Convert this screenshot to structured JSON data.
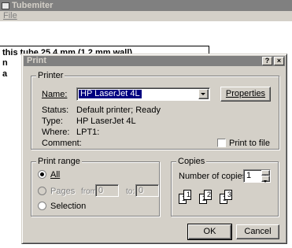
{
  "app": {
    "title": "Tubemiter",
    "menu": {
      "file": "File"
    },
    "document_lines": [
      "this tube 25.4 mm (1.2 mm wall)",
      "n",
      "a"
    ]
  },
  "dialog": {
    "title": "Print",
    "help_glyph": "?",
    "close_glyph": "×",
    "printer": {
      "group_label": "Printer",
      "name_label": "Name:",
      "name_value": "HP LaserJet 4L",
      "properties_button": "Properties",
      "status_label": "Status:",
      "status_value": "Default printer; Ready",
      "type_label": "Type:",
      "type_value": "HP LaserJet 4L",
      "where_label": "Where:",
      "where_value": "LPT1:",
      "comment_label": "Comment:",
      "print_to_file_label": "Print to file",
      "print_to_file_checked": false
    },
    "print_range": {
      "group_label": "Print range",
      "all_label": "All",
      "pages_label": "Pages",
      "from_label": "from:",
      "from_value": "0",
      "to_label": "to:",
      "to_value": "0",
      "selection_label": "Selection",
      "selected": "all"
    },
    "copies": {
      "group_label": "Copies",
      "number_label": "Number of copies:",
      "number_value": "1",
      "collate_pages": [
        "1",
        "1",
        "2",
        "2",
        "3",
        "3"
      ]
    },
    "ok_button": "OK",
    "cancel_button": "Cancel"
  }
}
